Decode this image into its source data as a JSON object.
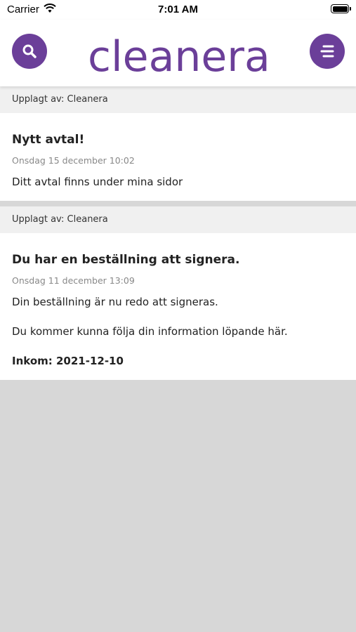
{
  "status_bar": {
    "carrier": "Carrier",
    "time": "7:01 AM"
  },
  "header": {
    "logo_text": "cleanera",
    "brand_color": "#6b3f99",
    "search_icon": "search-icon",
    "menu_icon": "menu-icon"
  },
  "posts": [
    {
      "meta": "Upplagt av: Cleanera",
      "title": "Nytt avtal!",
      "date": "Onsdag 15 december 10:02",
      "paragraphs": [
        "Ditt avtal finns under mina sidor"
      ]
    },
    {
      "meta": "Upplagt av: Cleanera",
      "title": "Du har en beställning att signera.",
      "date": "Onsdag 11 december 13:09",
      "paragraphs": [
        "Din beställning är nu redo att signeras.",
        "Du kommer kunna följa din information löpande här."
      ],
      "footer": "Inkom: 2021-12-10"
    }
  ]
}
